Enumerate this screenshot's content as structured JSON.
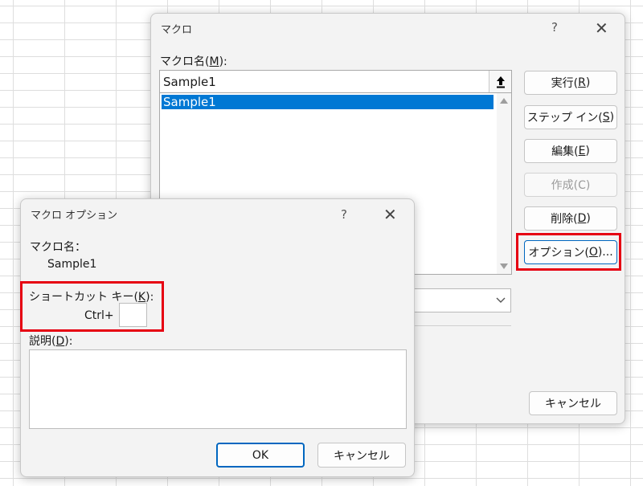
{
  "macro_dialog": {
    "title": "マクロ",
    "help": "?",
    "close": "✕",
    "name_label": "マクロ名(M):",
    "name_value": "Sample1",
    "list_items": [
      "Sample1"
    ],
    "buttons": {
      "run": "実行(R)",
      "step_in": "ステップ イン(S)",
      "edit": "編集(E)",
      "create": "作成(C)",
      "delete": "削除(D)",
      "options": "オプション(O)...",
      "cancel": "キャンセル"
    }
  },
  "options_dialog": {
    "title": "マクロ オプション",
    "help": "?",
    "close": "✕",
    "macro_name_label": "マクロ名：",
    "macro_name_value": "Sample1",
    "shortcut_label": "ショートカット キー(K):",
    "ctrl_prefix": "Ctrl+",
    "shortcut_value": "",
    "description_label": "説明(D):",
    "description_value": "",
    "ok": "OK",
    "cancel": "キャンセル"
  },
  "colors": {
    "highlight": "#e60012",
    "selection": "#0078d4"
  }
}
